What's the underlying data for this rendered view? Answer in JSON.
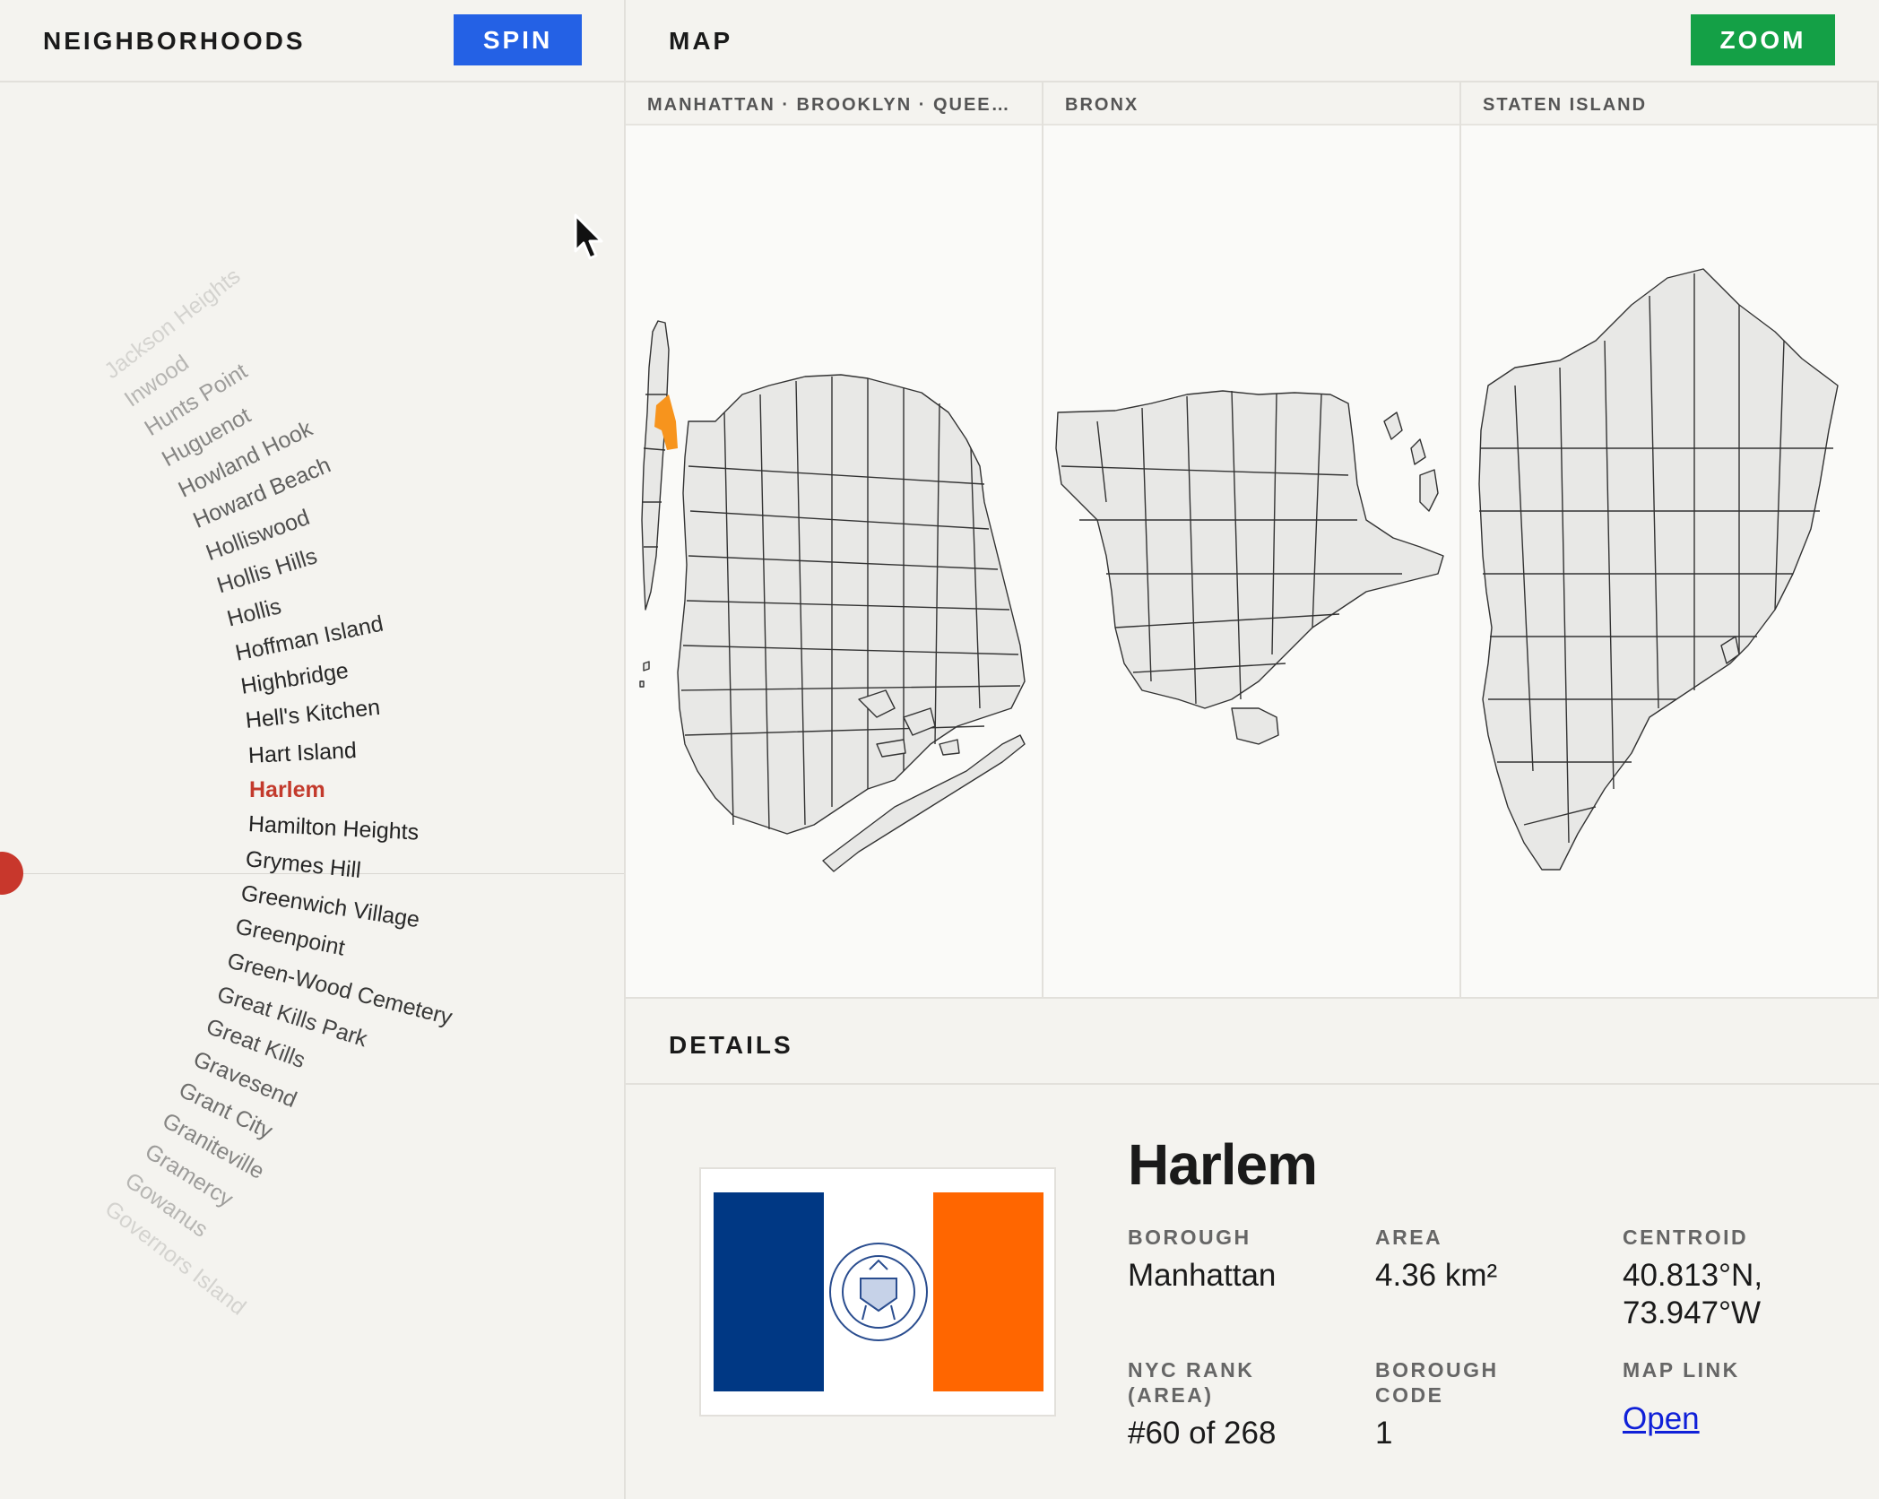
{
  "sidebar": {
    "title": "NEIGHBORHOODS",
    "spin_label": "SPIN",
    "selected": "Harlem",
    "wheel": [
      "Jackson Heights",
      "Inwood",
      "Hunts Point",
      "Huguenot",
      "Howland Hook",
      "Howard Beach",
      "Holliswood",
      "Hollis Hills",
      "Hollis",
      "Hoffman Island",
      "Highbridge",
      "Hell's Kitchen",
      "Hart Island",
      "Harlem",
      "Hamilton Heights",
      "Grymes Hill",
      "Greenwich Village",
      "Greenpoint",
      "Green-Wood Cemetery",
      "Great Kills Park",
      "Great Kills",
      "Gravesend",
      "Grant City",
      "Graniteville",
      "Gramercy",
      "Gowanus",
      "Governors Island"
    ]
  },
  "map": {
    "title": "MAP",
    "zoom_label": "ZOOM",
    "panels": [
      {
        "label": "MANHATTAN · BROOKLYN · QUEE…"
      },
      {
        "label": "BRONX"
      },
      {
        "label": "STATEN ISLAND"
      }
    ],
    "highlight_color": "#f7941d"
  },
  "details": {
    "title": "DETAILS",
    "name": "Harlem",
    "borough_label": "BOROUGH",
    "borough": "Manhattan",
    "area_label": "AREA",
    "area": "4.36 km²",
    "centroid_label": "CENTROID",
    "centroid_lat": "40.813°N,",
    "centroid_lon": "73.947°W",
    "rank_label_1": "NYC RANK",
    "rank_label_2": "(AREA)",
    "rank": "#60 of 268",
    "code_label_1": "BOROUGH",
    "code_label_2": "CODE",
    "code": "1",
    "maplink_label": "MAP LINK",
    "maplink_text": "Open",
    "flag": {
      "left_color": "#003884",
      "right_color": "#ff6600",
      "seal_color": "#2a4d8f"
    }
  },
  "colors": {
    "spin": "#2461e5",
    "zoom": "#14a046",
    "selected": "#c33a2c"
  }
}
